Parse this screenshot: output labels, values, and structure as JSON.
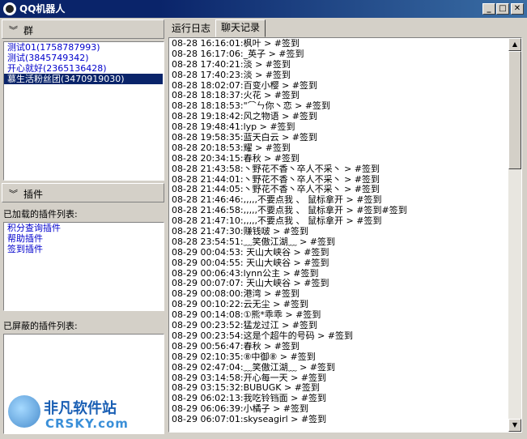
{
  "window": {
    "title": "QQ机器人"
  },
  "left": {
    "groups_header": "群",
    "groups": [
      "测试01(1758787993)",
      "测试(3845749342)",
      "开心就好(2365136428)",
      "慕生活粉丝团(3470919030)"
    ],
    "selected_group_index": 3,
    "plugins_header": "插件",
    "loaded_label": "已加载的插件列表:",
    "loaded_plugins": [
      "积分查询插件",
      "帮助插件",
      "签到插件"
    ],
    "blocked_label": "已屏蔽的插件列表:"
  },
  "tabs": [
    "运行日志",
    "聊天记录"
  ],
  "active_tab_index": 1,
  "log": [
    "08-28 16:16:01:枫叶 > #签到",
    "08-28 16:17:06:_英子 > #签到",
    "08-28 17:40:21:淡 > #签到",
    "08-28 17:40:23:淡 > #签到",
    "08-28 18:02:07:百变小樱 > #签到",
    "08-28 18:18:37:火花 > #签到",
    "08-28 18:18:53:\"⌒ㄣ你丶恋 > #签到",
    "08-28 19:18:42:风之物语 > #签到",
    "08-28 19:48:41:lyp > #签到",
    "08-28 19:58:35:蓝天白云 > #签到",
    "08-28 20:18:53:耀 > #签到",
    "08-28 20:34:15:春秋 > #签到",
    "08-28 21:43:58:丶野花不香丶卒人不采丶 > #签到",
    "08-28 21:44:01:丶野花不香丶卒人不采丶 > #签到",
    "08-28 21:44:05:丶野花不香丶卒人不采丶 > #签到",
    "08-28 21:46:46:,,,,,不要点我 、 鼠标拿开 > #签到",
    "08-28 21:46:58:,,,,,不要点我 、 鼠标拿开 > #签到#签到",
    "08-28 21:47:10:,,,,,不要点我 、 鼠标拿开 > #签到",
    "08-28 21:47:30:赚钱啵 > #签到",
    "08-28 23:54:51:﹏笑傲江湖﹏ > #签到",
    "08-29 00:04:53: 天山大峡谷 > #签到",
    "08-29 00:04:55: 天山大峡谷 > #签到",
    "08-29 00:06:43:lynn公主 > #签到",
    "08-29 00:07:07: 天山大峡谷 > #签到",
    "08-29 00:08:00:港湾 > #签到",
    "08-29 00:10:22:云无尘 > #签到",
    "08-29 00:14:08:①熊*乖乖 > #签到",
    "08-29 00:23:52:猛龙过江 > #签到",
    "08-29 00:23:54:这是个超牛的号码 > #签到",
    "08-29 00:56:47:春秋 > #签到",
    "08-29 02:10:35:⑧中御⑧ > #签到",
    "08-29 02:47:04:﹏笑傲江湖﹏ > #签到",
    "08-29 03:14:58:开心每一天 > #签到",
    "08-29 03:15:32:BUBUGK > #签到",
    "08-29 06:02:13:我吃铃铛面 > #签到",
    "08-29 06:06:39:小橘子 > #签到",
    "08-29 06:07:01:skyseagirl > #签到"
  ],
  "watermark": {
    "name": "非凡软件站",
    "site": "CRSKY.com"
  }
}
